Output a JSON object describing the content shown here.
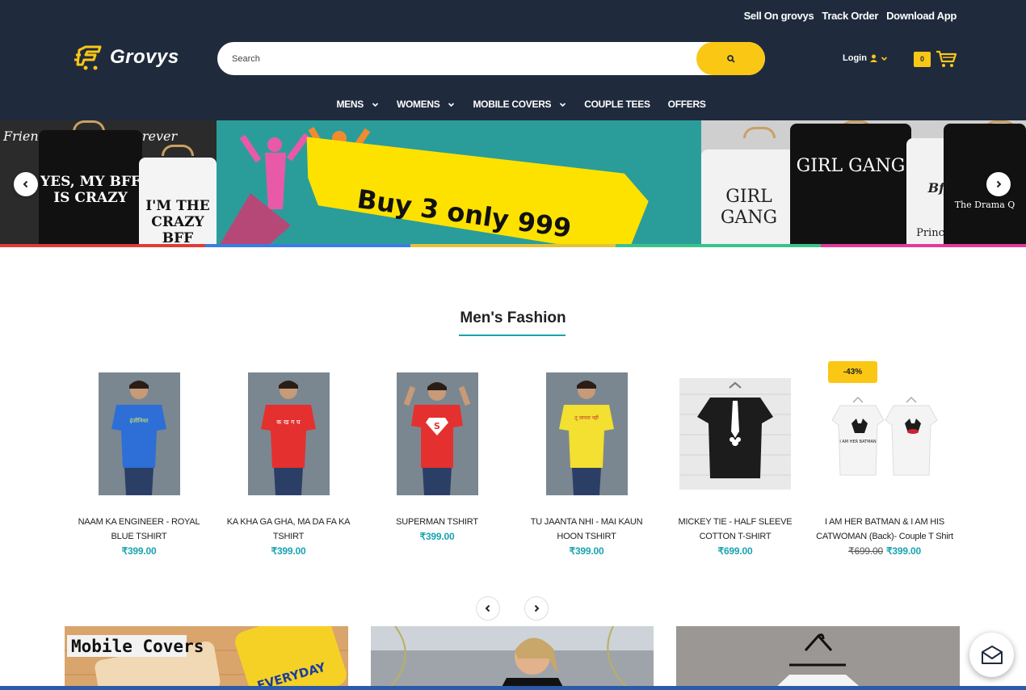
{
  "toplinks": [
    "Sell On grovys",
    "Track Order",
    "Download App"
  ],
  "logo": {
    "name": "Grovys"
  },
  "search": {
    "placeholder": "Search"
  },
  "login": {
    "label": "Login"
  },
  "cart": {
    "count": "0"
  },
  "nav": [
    "MENS",
    "WOMENS",
    "MOBILE COVERS",
    "COUPLE TEES",
    "OFFERS"
  ],
  "banner": {
    "promo": "Buy 3 only 999",
    "left_words": [
      "Friends",
      "Forever"
    ],
    "tee_texts": [
      "YES, MY BFF IS CRAZY",
      "I'M THE CRAZY BFF",
      "GIRL GANG",
      "GIRL GANG",
      "Bff",
      "Princess",
      "The Drama Q"
    ]
  },
  "section": {
    "title": "Men's Fashion"
  },
  "products": [
    {
      "name": "NAAM KA ENGINEER - ROYAL BLUE TSHIRT",
      "price": "₹399.00",
      "old_price": "",
      "tee_color": "#2d6fd6",
      "print": "इंजीनियर"
    },
    {
      "name": "KA KHA GA GHA, MA DA FA KA TSHIRT",
      "price": "₹399.00",
      "old_price": "",
      "tee_color": "#e53030",
      "print": "क ख ग घ"
    },
    {
      "name": "SUPERMAN TSHIRT",
      "price": "₹399.00",
      "old_price": "",
      "tee_color": "#e53030",
      "print": "S"
    },
    {
      "name": "TU JAANTA NHI - MAI KAUN HOON TSHIRT",
      "price": "₹399.00",
      "old_price": "",
      "tee_color": "#f3e030",
      "print": "तू जानता नहीं"
    },
    {
      "name": "MICKEY TIE - HALF SLEEVE COTTON T-SHIRT",
      "price": "₹699.00",
      "old_price": "",
      "tee_color": "#1c1c1c",
      "print": ""
    },
    {
      "name": "I AM HER BATMAN & I AM HIS CATWOMAN (Back)- Couple T Shirt",
      "price": "₹399.00",
      "old_price": "₹699.00",
      "tee_color": "#f4f4f4",
      "print": "I AM HER BATMAN"
    }
  ],
  "badge": "-43%",
  "categories": [
    {
      "label": "Mobile Covers",
      "cover_text": "EVERYDAY"
    },
    {
      "label": ""
    },
    {
      "label": ""
    }
  ],
  "colors": {
    "header": "#1f2b3d",
    "accent": "#fbc715",
    "price": "#1aa3b0"
  },
  "icons": [
    "search-icon",
    "user-icon",
    "chevron-down-icon",
    "cart-icon",
    "chevron-left-icon",
    "chevron-right-icon",
    "mail-icon"
  ]
}
